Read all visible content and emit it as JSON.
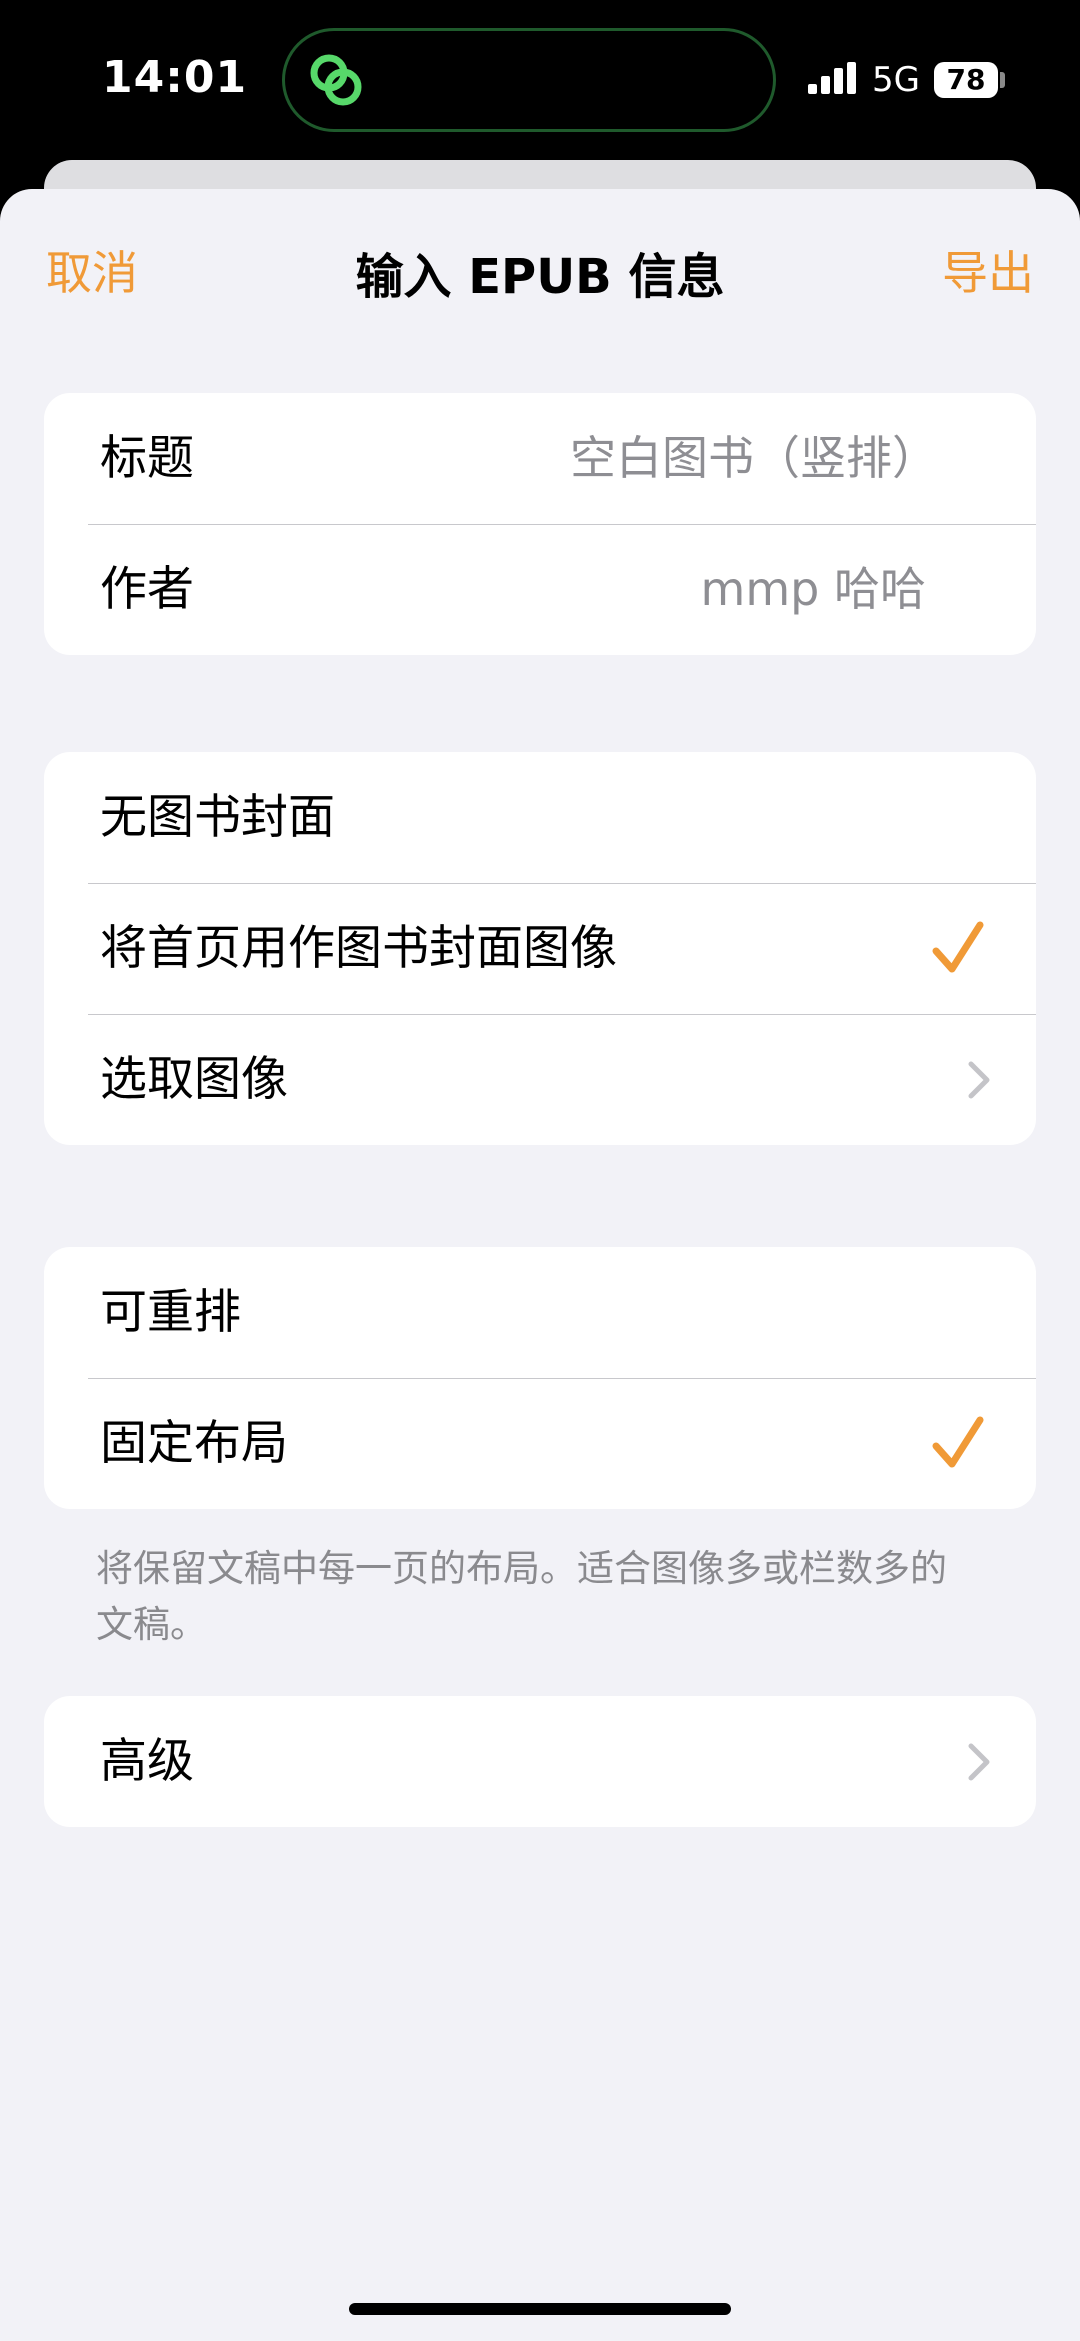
{
  "status": {
    "time": "14:01",
    "network": "5G",
    "battery": "78"
  },
  "nav": {
    "cancel": "取消",
    "title": "输入 EPUB 信息",
    "export": "导出"
  },
  "info": [
    {
      "label": "标题",
      "value": "空白图书（竖排）"
    },
    {
      "label": "作者",
      "value": "mmp 哈哈"
    }
  ],
  "cover_options": [
    {
      "label": "无图书封面",
      "checked": false
    },
    {
      "label": "将首页用作图书封面图像",
      "checked": true
    },
    {
      "label": "选取图像",
      "disclosure": true
    }
  ],
  "layout_options": [
    {
      "label": "可重排",
      "checked": false
    },
    {
      "label": "固定布局",
      "checked": true
    }
  ],
  "layout_footnote": "将保留文稿中每一页的布局。适合图像多或栏数多的文稿。",
  "advanced": {
    "label": "高级"
  },
  "colors": {
    "accent": "#f09a37",
    "background": "#f2f2f7",
    "secondary_text": "#8e8e93"
  },
  "icons": {
    "island": "link-rings-icon",
    "check": "checkmark-icon",
    "chevron": "chevron-right-icon"
  }
}
